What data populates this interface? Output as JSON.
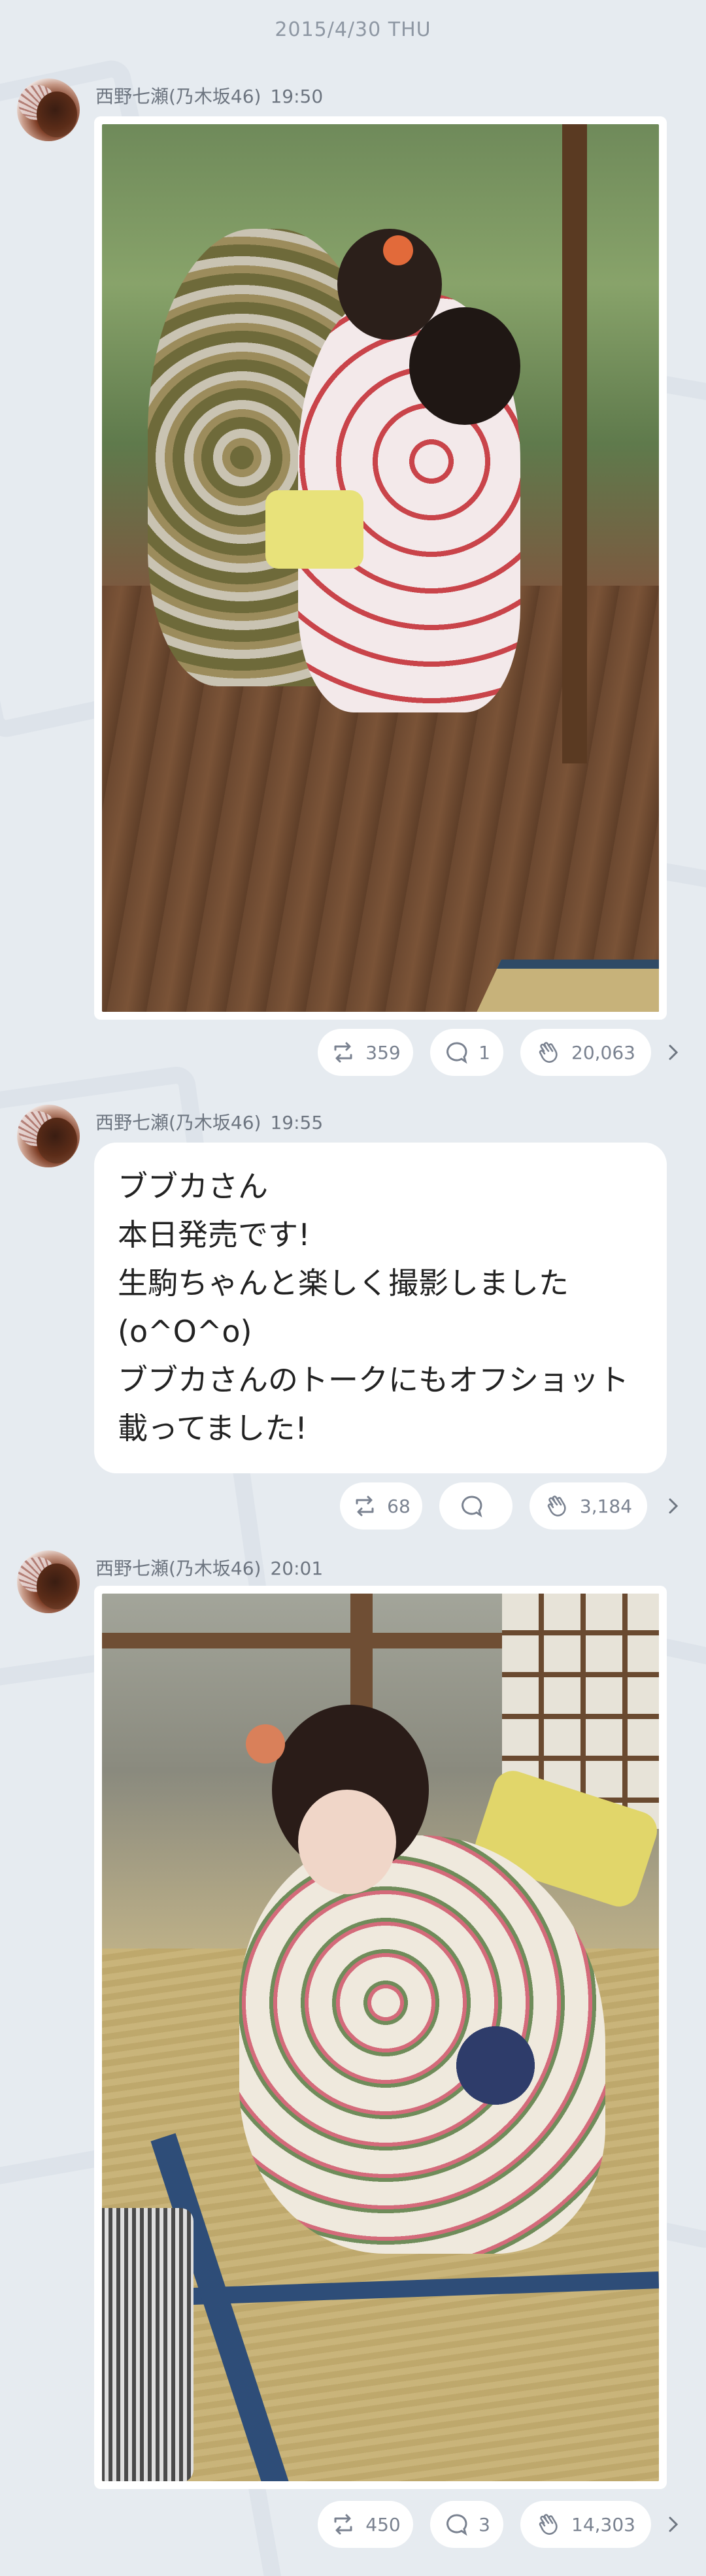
{
  "date_header": "2015/4/30 THU",
  "posts": [
    {
      "author": "西野七瀬(乃木坂46)",
      "time": "19:50",
      "type": "image",
      "image_desc": "photo-two-girls-kimono",
      "retweets": "359",
      "comments": "1",
      "likes": "20,063"
    },
    {
      "author": "西野七瀬(乃木坂46)",
      "time": "19:55",
      "type": "text",
      "text_lines": [
        "ブブカさん",
        "本日発売です!",
        "生駒ちゃんと楽しく撮影しました",
        "(o^O^o)",
        "ブブカさんのトークにもオフショット",
        "載ってました!"
      ],
      "retweets": "68",
      "comments": "",
      "likes": "3,184"
    },
    {
      "author": "西野七瀬(乃木坂46)",
      "time": "20:01",
      "type": "image",
      "image_desc": "photo-girl-kimono-tatami",
      "retweets": "450",
      "comments": "3",
      "likes": "14,303"
    }
  ],
  "colors": {
    "background": "#e6ebf0",
    "card": "#ffffff",
    "meta_text": "#6d7580",
    "icon": "#7a8290"
  },
  "icons": {
    "retweet": "retweet-icon",
    "comment": "comment-icon",
    "like": "clap-icon",
    "more": "chevron-right-icon"
  }
}
